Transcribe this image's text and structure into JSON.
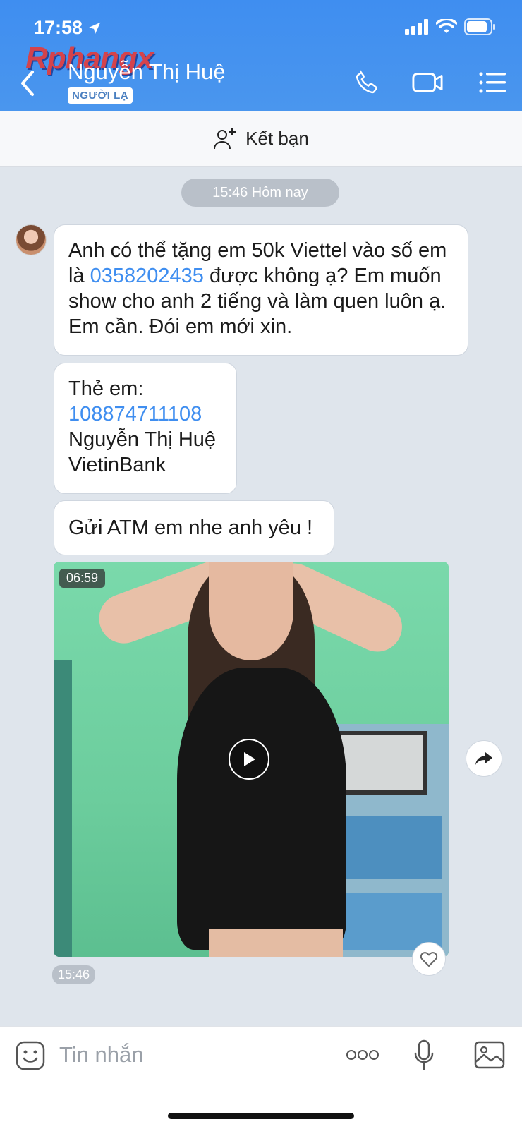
{
  "status": {
    "time": "17:58"
  },
  "header": {
    "watermark": "Rphangx",
    "contact_name": "Nguyễn Thị Huệ",
    "badge": "NGƯỜI LẠ"
  },
  "friend_bar": {
    "label": "Kết bạn"
  },
  "chat": {
    "date_divider": "15:46 Hôm nay",
    "messages": [
      {
        "text_before": "Anh có thể tặng em 50k Viettel vào số em là ",
        "link": "0358202435",
        "text_after": " được không ạ? Em muốn show cho anh 2 tiếng và làm quen luôn ạ. Em cần. Đói em mới xin."
      },
      {
        "line1": "Thẻ em:",
        "link": "108874711108",
        "line3": "Nguyễn Thị Huệ",
        "line4": "VietinBank"
      },
      {
        "text": "Gửi ATM em nhe anh yêu !"
      }
    ],
    "video": {
      "duration": "06:59",
      "time": "15:46"
    }
  },
  "input": {
    "placeholder": "Tin nhắn"
  },
  "colors": {
    "header": "#3f8ef0",
    "link": "#3f8ef0",
    "chat_bg": "#dfe5ec"
  }
}
